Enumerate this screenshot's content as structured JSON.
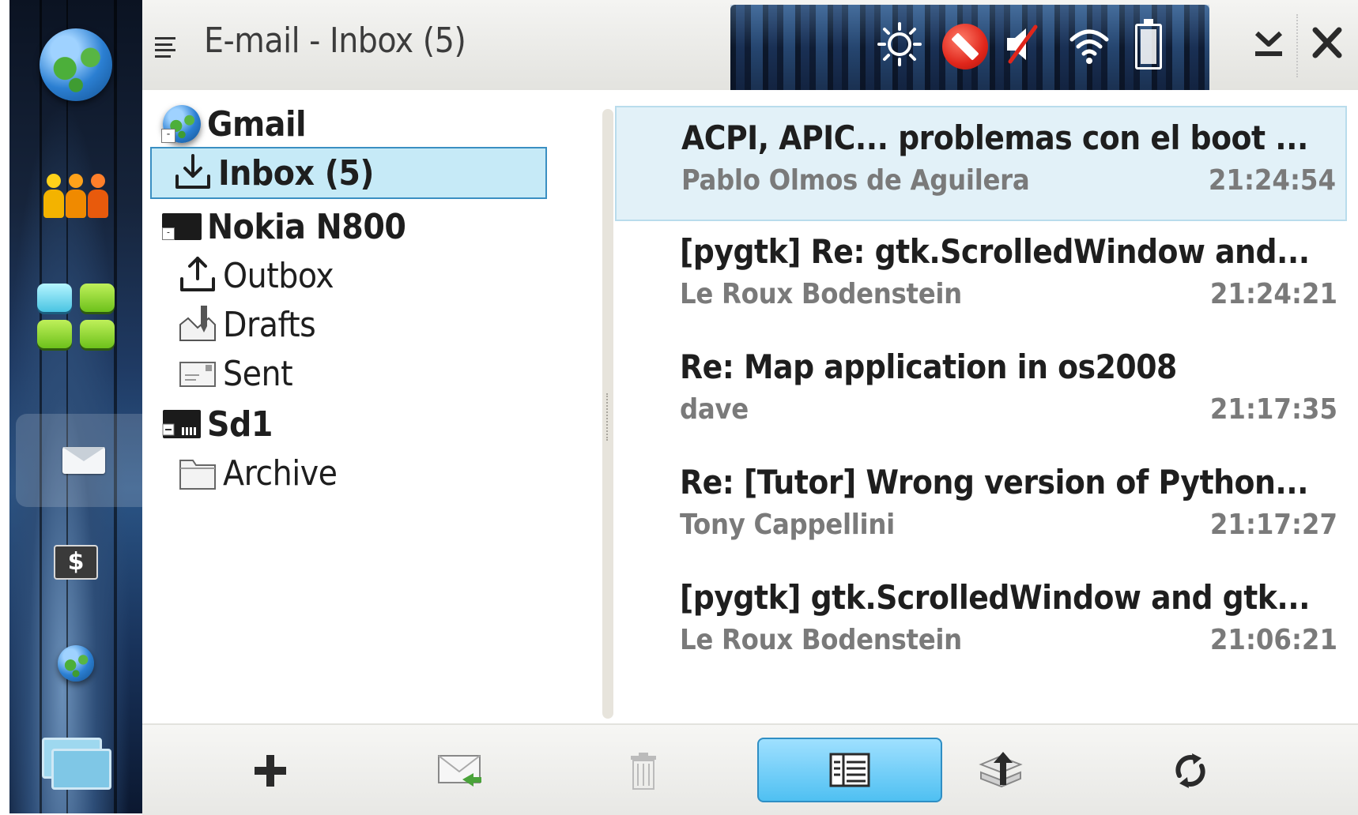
{
  "window": {
    "title": "E-mail - Inbox (5)"
  },
  "launcher": {
    "items": [
      {
        "icon": "web-browser-icon"
      },
      {
        "icon": "contacts-icon"
      },
      {
        "icon": "applications-icon"
      },
      {
        "icon": "email-icon"
      },
      {
        "icon": "money-icon"
      },
      {
        "icon": "internet-icon"
      },
      {
        "icon": "task-switcher-icon"
      }
    ]
  },
  "status_bar": {
    "icons": [
      "brightness-icon",
      "presence-offline-icon",
      "volume-muted-icon",
      "wifi-icon",
      "battery-icon"
    ]
  },
  "folders": [
    {
      "label": "Gmail",
      "type": "account",
      "icon": "globe-icon"
    },
    {
      "label": "Inbox (5)",
      "type": "folder",
      "icon": "inbox-icon",
      "selected": true
    },
    {
      "label": "Nokia N800",
      "type": "account",
      "icon": "device-icon"
    },
    {
      "label": "Outbox",
      "type": "folder",
      "icon": "outbox-icon"
    },
    {
      "label": "Drafts",
      "type": "folder",
      "icon": "drafts-icon"
    },
    {
      "label": "Sent",
      "type": "folder",
      "icon": "sent-icon"
    },
    {
      "label": "Sd1",
      "type": "account",
      "icon": "memory-card-icon"
    },
    {
      "label": "Archive",
      "type": "folder",
      "icon": "folder-icon"
    }
  ],
  "messages": [
    {
      "subject": "ACPI, APIC... problemas con el boot ...",
      "sender": "Pablo Olmos de Aguilera",
      "time": "21:24:54",
      "selected": true
    },
    {
      "subject": "[pygtk] Re: gtk.ScrolledWindow and...",
      "sender": "Le Roux Bodenstein",
      "time": "21:24:21"
    },
    {
      "subject": "Re: Map application in os2008",
      "sender": "dave",
      "time": "21:17:35"
    },
    {
      "subject": "Re: [Tutor] Wrong version of Python...",
      "sender": "Tony Cappellini",
      "time": "21:17:27"
    },
    {
      "subject": "[pygtk] gtk.ScrolledWindow and gtk...",
      "sender": "Le Roux Bodenstein",
      "time": "21:06:21"
    }
  ],
  "toolbar": {
    "buttons": [
      {
        "icon": "new-message-icon"
      },
      {
        "icon": "send-receive-icon"
      },
      {
        "icon": "delete-icon"
      },
      {
        "icon": "message-list-view-icon",
        "active": true
      },
      {
        "icon": "move-to-folder-icon"
      },
      {
        "icon": "refresh-icon"
      }
    ]
  },
  "colors": {
    "selection_fill": "#c6eaf7",
    "selection_border": "#3a8fc2",
    "active_tool": "#4fc0f2",
    "sender_text": "#7a7a7a"
  }
}
